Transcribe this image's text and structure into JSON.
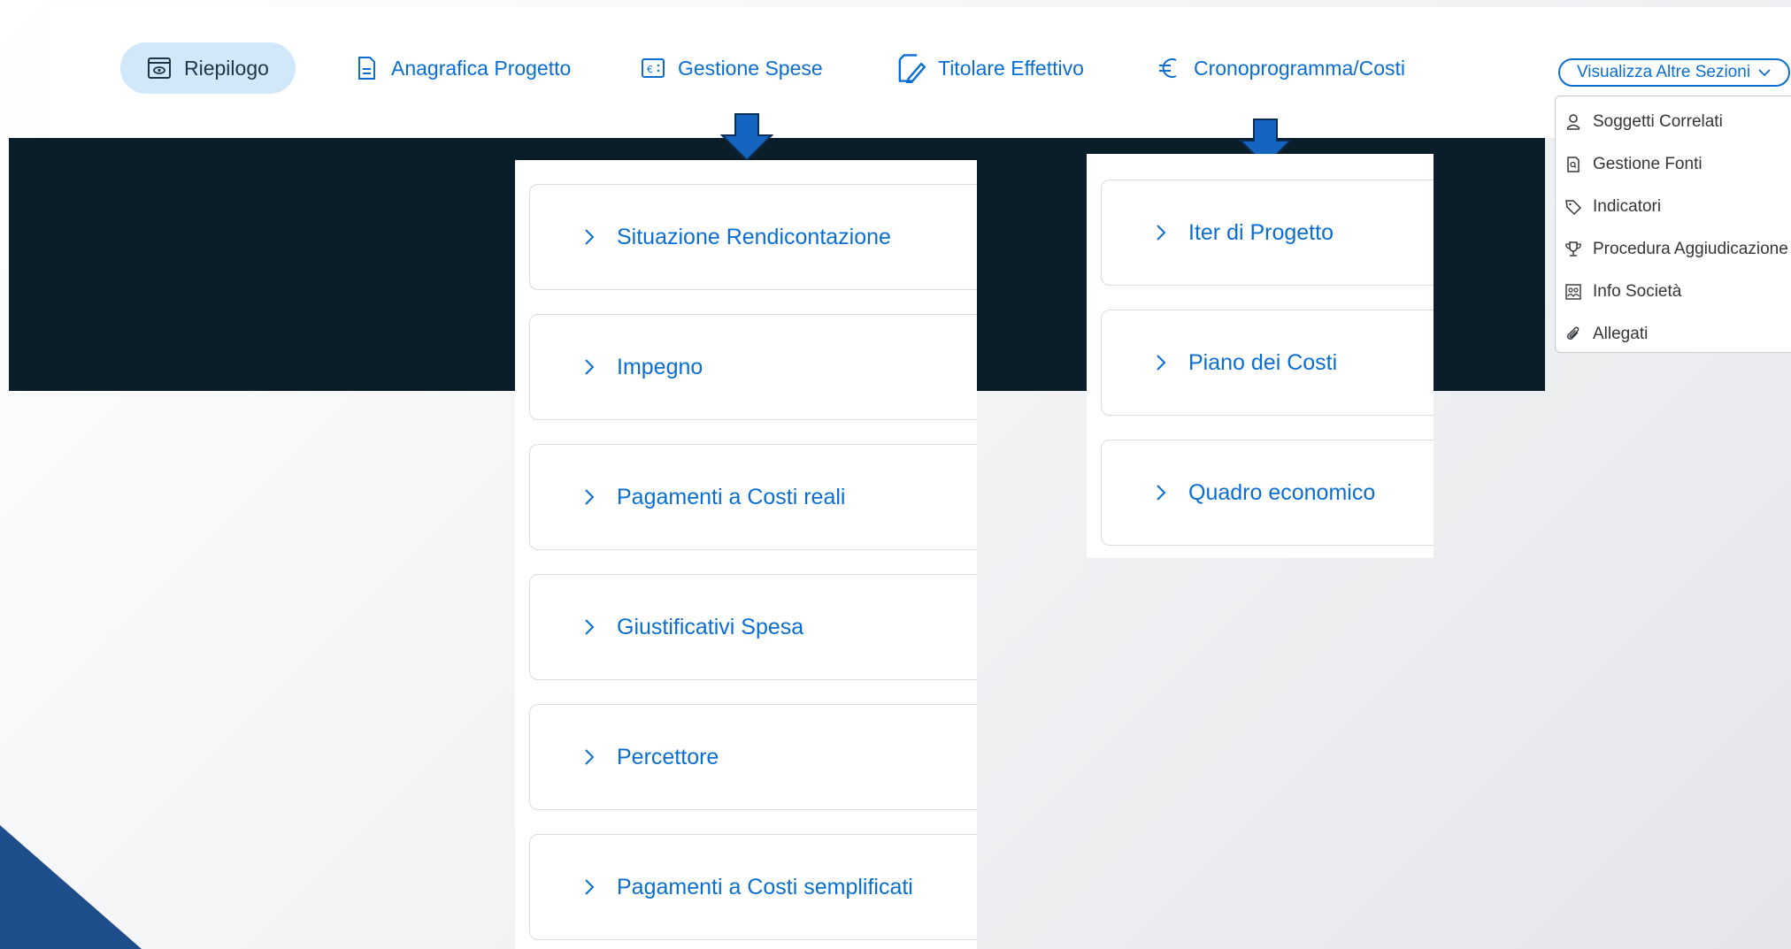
{
  "tabs": [
    {
      "label": "Riepilogo",
      "icon": "eye-window-icon",
      "active": true
    },
    {
      "label": "Anagrafica Progetto",
      "icon": "document-icon",
      "active": false
    },
    {
      "label": "Gestione Spese",
      "icon": "euro-screen-icon",
      "active": false
    },
    {
      "label": "Titolare Effettivo",
      "icon": "edit-document-icon",
      "active": false
    },
    {
      "label": "Cronoprogramma/Costi",
      "icon": "euro-icon",
      "active": false
    }
  ],
  "more_sections": {
    "label": "Visualizza Altre Sezioni",
    "items": [
      {
        "label": "Soggetti Correlati",
        "icon": "person-icon"
      },
      {
        "label": "Gestione Fonti",
        "icon": "search-document-icon"
      },
      {
        "label": "Indicatori",
        "icon": "tag-icon"
      },
      {
        "label": "Procedura Aggiudicazione",
        "icon": "trophy-icon"
      },
      {
        "label": "Info Società",
        "icon": "company-people-icon"
      },
      {
        "label": "Allegati",
        "icon": "paperclip-icon"
      }
    ]
  },
  "gestione_spese_panel": {
    "items": [
      "Situazione Rendicontazione",
      "Impegno",
      "Pagamenti a Costi reali",
      "Giustificativi Spesa",
      "Percettore",
      "Pagamenti a Costi semplificati"
    ]
  },
  "cronoprogramma_panel": {
    "items": [
      "Iter di Progetto",
      "Piano dei Costi",
      "Quadro economico"
    ]
  },
  "colors": {
    "accent": "#0a6ed1",
    "active_tab_bg": "#d1e8fb",
    "dark_band": "#0a1e2a",
    "arrow": "#1565c0"
  }
}
